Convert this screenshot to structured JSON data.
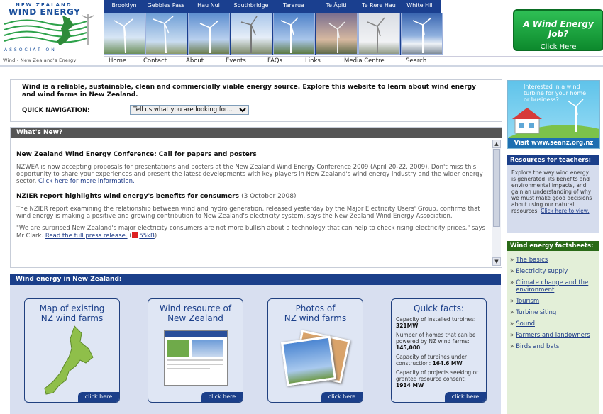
{
  "header": {
    "logo_line1": "NEW ZEALAND",
    "logo_line2": "WIND ENERGY",
    "logo_line3": "ASSOCIATION",
    "tagline": "Wind - New Zealand's Energy",
    "farm_nav": [
      "Brooklyn",
      "Gebbies Pass",
      "Hau Nui",
      "Southbridge",
      "Tararua",
      "Te Āpiti",
      "Te Rere Hau",
      "White Hill"
    ],
    "job_title": "A Wind Energy Job?",
    "job_cta": "Click Here"
  },
  "main_nav": [
    "Home",
    "Contact",
    "About",
    "Events",
    "FAQs",
    "Links",
    "Media Centre",
    "Search"
  ],
  "intro": {
    "text": "Wind is a reliable, sustainable, clean and commercially viable energy source. Explore this website to learn about wind energy and wind farms in New Zealand.",
    "quick_nav_label": "QUICK NAVIGATION:",
    "quick_nav_selected": "Tell us what you are looking for..."
  },
  "whats_new": {
    "title": "What's New?",
    "news1_title": "New Zealand Wind Energy Conference: Call for papers and posters",
    "news1_body": "NZWEA is now accepting proposals for presentations and posters at the New Zealand Wind Energy Conference 2009 (April 20-22, 2009). Don't miss this opportunity to share your experiences and present the latest developments with key players in New Zealand's wind energy industry and the wider energy sector.",
    "news1_link": "Click here for more information.",
    "news2_title": "NZIER report highlights wind energy's benefits for consumers",
    "news2_date": "(3 October 2008)",
    "news2_body1": "The NZIER report examining the relationship between wind and hydro generation, released yesterday by the Major Electricity Users' Group, confirms that wind energy is making a positive and growing contribution to New Zealand's electricity system, says the New Zealand Wind Energy Association.",
    "news2_body2": "\"We are surprised New Zealand's major electricity consumers are not more bullish about a technology that can help to check rising electricity prices,\" says Mr Clark.",
    "news2_link": "Read the full press release.",
    "news2_pdf": "55kB"
  },
  "wind_nz": {
    "title": "Wind energy in New Zealand:",
    "card1_title_a": "Map of existing",
    "card1_title_b": "NZ wind farms",
    "card2_title_a": "Wind resource of",
    "card2_title_b": "New Zealand",
    "card3_title_a": "Photos of",
    "card3_title_b": "NZ wind farms",
    "card4_title": "Quick facts:",
    "click_here": "click here",
    "fact1_label": "Capacity of installed turbines:",
    "fact1_value": "321MW",
    "fact2_label": "Number of homes that can be powered by NZ wind farms:",
    "fact2_value": "145,000",
    "fact3_label": "Capacity of turbines under construction:",
    "fact3_value": "164.6 MW",
    "fact4_label": "Capacity of projects seeking or granted resource consent:",
    "fact4_value": "1914 MW"
  },
  "seanz": {
    "question": "Interested in a wind turbine for your home or business?",
    "visit": "Visit www.seanz.org.nz"
  },
  "teachers": {
    "title": "Resources for teachers:",
    "text": "Explore the way wind energy is generated, its benefits and environmental impacts, and gain an understanding of why we must make good decisions about using our natural resources.",
    "link": "Click here to view."
  },
  "factsheets": {
    "title": "Wind energy factsheets:",
    "items": [
      "The basics",
      "Electricity supply",
      "Climate change and the environment",
      "Tourism",
      "Turbine siting",
      "Sound",
      "Farmers and landowners",
      "Birds and bats"
    ]
  },
  "colors": {
    "nav_blue": "#1b3f8a",
    "header_grey": "#555555",
    "factsheet_green": "#2a6a18",
    "job_green": "#1aa640"
  }
}
